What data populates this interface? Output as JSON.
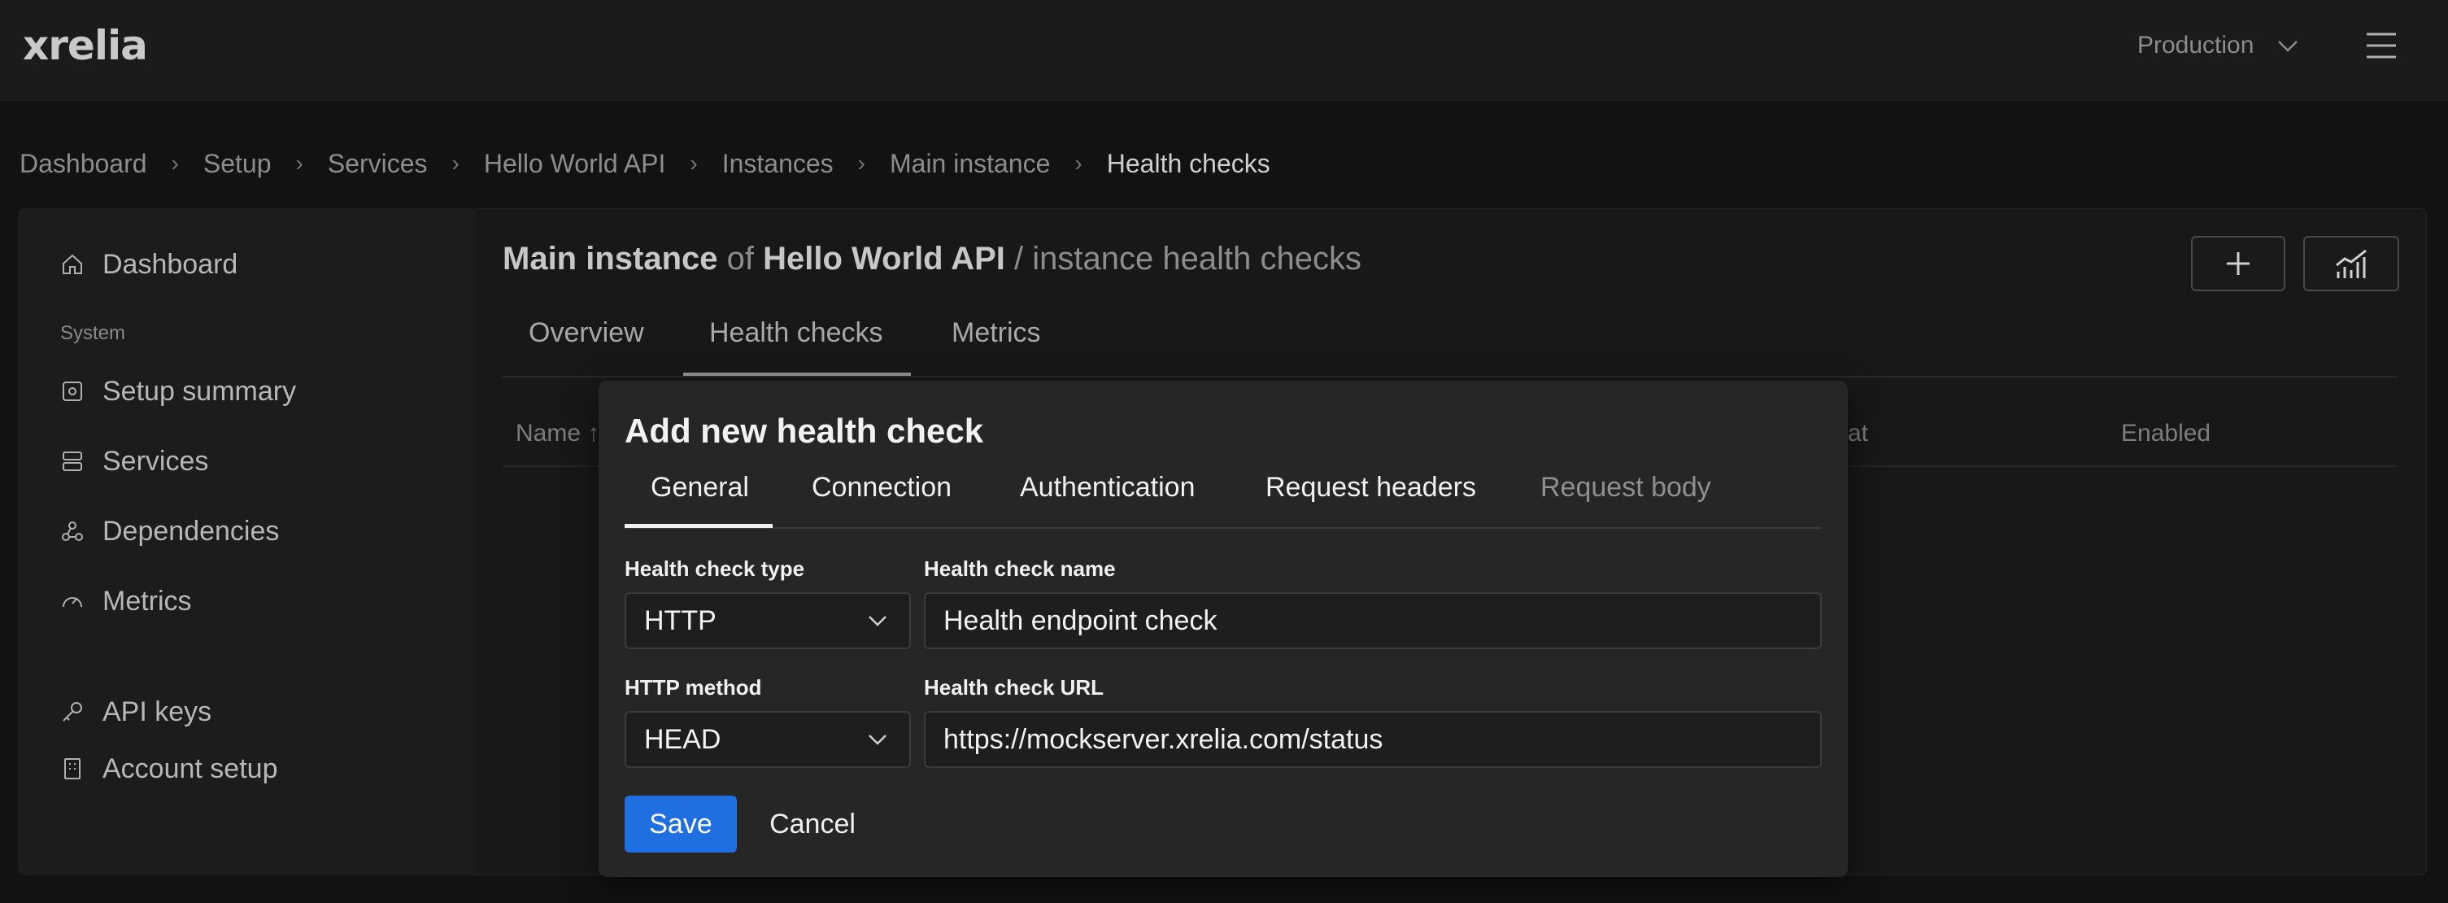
{
  "app": {
    "logo": "xrelia",
    "environment": "Production"
  },
  "breadcrumb": [
    "Dashboard",
    "Setup",
    "Services",
    "Hello World API",
    "Instances",
    "Main instance",
    "Health checks"
  ],
  "sidebar": {
    "dashboard": "Dashboard",
    "section_system": "System",
    "setup_summary": "Setup summary",
    "services": "Services",
    "dependencies": "Dependencies",
    "metrics": "Metrics",
    "api_keys": "API keys",
    "account_setup": "Account setup"
  },
  "page": {
    "title_instance": "Main instance",
    "title_of": "of",
    "title_service": "Hello World API",
    "title_suffix": "/ instance health checks"
  },
  "main_tabs": [
    "Overview",
    "Health checks",
    "Metrics"
  ],
  "table": {
    "col_name": "Name ↑",
    "col_status_fragment": "at",
    "col_enabled": "Enabled"
  },
  "modal": {
    "title": "Add new health check",
    "tabs": [
      "General",
      "Connection",
      "Authentication",
      "Request headers",
      "Request body"
    ],
    "type_label": "Health check type",
    "type_value": "HTTP",
    "name_label": "Health check name",
    "name_value": "Health endpoint check",
    "method_label": "HTTP method",
    "method_value": "HEAD",
    "url_label": "Health check URL",
    "url_value": "https://mockserver.xrelia.com/status",
    "save": "Save",
    "cancel": "Cancel"
  },
  "colors": {
    "primary": "#1f6fe0",
    "background": "#121212",
    "modal": "#262626"
  }
}
